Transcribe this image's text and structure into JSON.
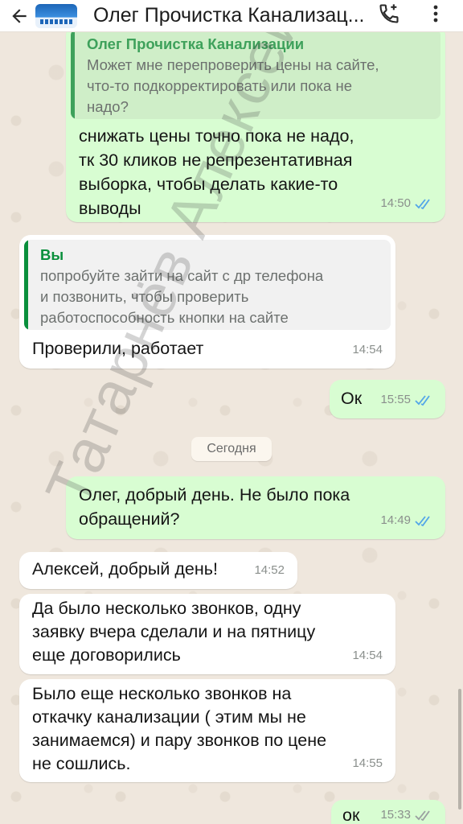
{
  "header": {
    "title": "Олег Прочистка Канализац...",
    "icons": {
      "back": "arrow-left-icon",
      "call": "add-call-icon",
      "menu": "more-vert-icon"
    }
  },
  "colors": {
    "outgoing": "#d8fdd2",
    "incoming": "#ffffff",
    "quote_out": "#3ea15b",
    "quote_in": "#0a8f3c",
    "ticks": "#53a6e8"
  },
  "messages": [
    {
      "quote_name": "Олег Прочистка Канализации",
      "quote_text": [
        "Может мне перепроверить цены на сайте,",
        "что-то подкорректировать или пока не",
        "надо?"
      ],
      "text": "снижать цены точно пока не надо,\nтк 30 кликов не репрезентативная\nвыборка, чтобы делать какие-то\nвыводы",
      "time": "14:50"
    },
    {
      "quote_name": "Вы",
      "quote_text": [
        "попробуйте зайти на сайт с др телефона",
        "и позвонить, чтобы проверить",
        "работоспособность кнопки на сайте"
      ],
      "text": "Проверили, работает",
      "time": "14:54"
    },
    {
      "text": "Ок",
      "time": "15:55"
    },
    {
      "text": "Олег, добрый день. Не было пока\nобращений?",
      "time": "14:49"
    },
    {
      "text": "Алексей, добрый день!",
      "time": "14:52"
    },
    {
      "text": "Да было несколько звонков, одну\nзаявку вчера сделали и на пятницу\nеще договорились",
      "time": "14:54"
    },
    {
      "text": "Было еще несколько звонков на\nоткачку канализации ( этим мы не\nзанимаемся) и пару звонков по цене\nне сошлись.",
      "time": "14:55"
    },
    {
      "text": "ок",
      "time": "15:33"
    }
  ],
  "day_separator": "Сегодня",
  "watermark": "Татарнёв Алексей"
}
